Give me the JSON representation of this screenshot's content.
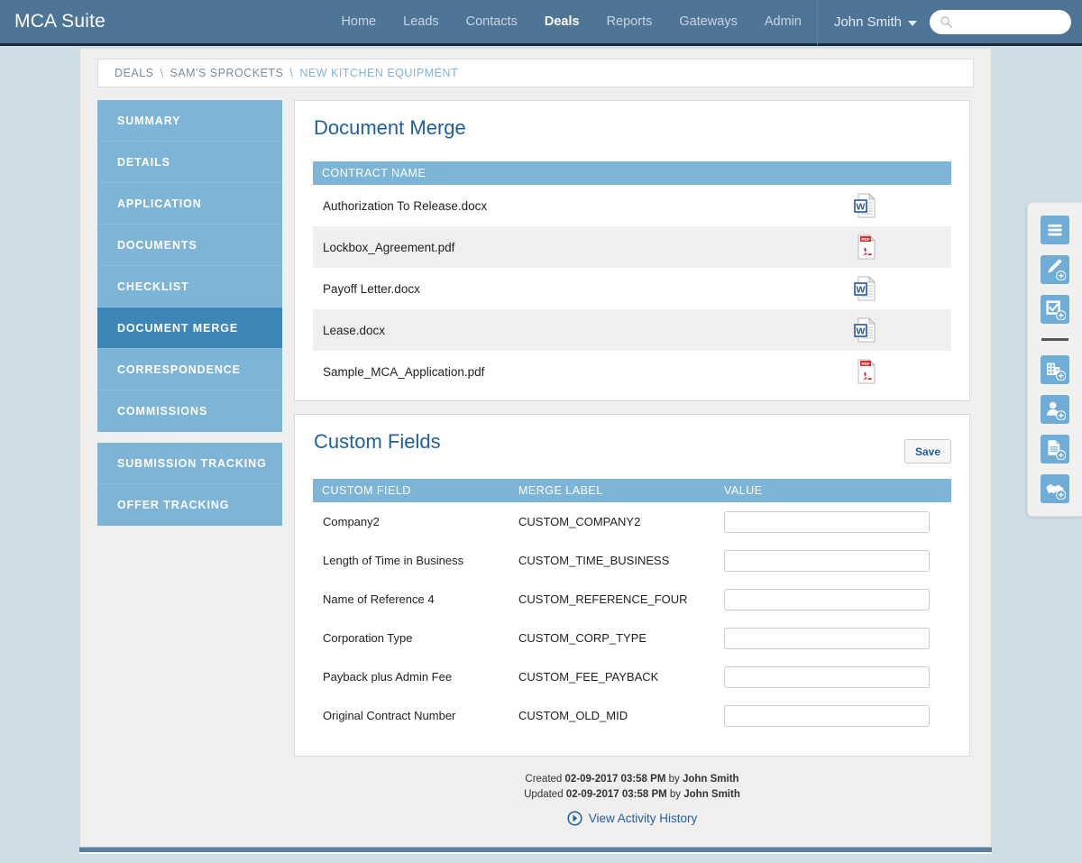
{
  "app": {
    "brand": "MCA Suite"
  },
  "topnav": {
    "links": [
      {
        "label": "Home",
        "active": false
      },
      {
        "label": "Leads",
        "active": false
      },
      {
        "label": "Contacts",
        "active": false
      },
      {
        "label": "Deals",
        "active": true
      },
      {
        "label": "Reports",
        "active": false
      },
      {
        "label": "Gateways",
        "active": false
      },
      {
        "label": "Admin",
        "active": false
      }
    ],
    "user": "John Smith",
    "search_placeholder": "",
    "search_value": "",
    "search_icon": "search-icon"
  },
  "breadcrumb": {
    "items": [
      {
        "label": "DEALS",
        "link": false
      },
      {
        "label": "SAM'S SPROCKETS",
        "link": false
      },
      {
        "label": "NEW KITCHEN EQUIPMENT",
        "link": true
      }
    ],
    "separator": "\\"
  },
  "sidebar": {
    "group1": [
      {
        "label": "SUMMARY",
        "active": false
      },
      {
        "label": "DETAILS",
        "active": false
      },
      {
        "label": "APPLICATION",
        "active": false
      },
      {
        "label": "DOCUMENTS",
        "active": false
      },
      {
        "label": "CHECKLIST",
        "active": false
      },
      {
        "label": "DOCUMENT MERGE",
        "active": true
      },
      {
        "label": "CORRESPONDENCE",
        "active": false
      },
      {
        "label": "COMMISSIONS",
        "active": false
      }
    ],
    "group2": [
      {
        "label": "SUBMISSION TRACKING",
        "active": false
      },
      {
        "label": "OFFER TRACKING",
        "active": false
      }
    ]
  },
  "document_merge": {
    "title": "Document Merge",
    "column_header": "CONTRACT NAME",
    "rows": [
      {
        "name": "Authorization To Release.docx",
        "icon": "word-document-icon",
        "type": "docx"
      },
      {
        "name": "Lockbox_Agreement.pdf",
        "icon": "pdf-document-icon",
        "type": "pdf"
      },
      {
        "name": "Payoff Letter.docx",
        "icon": "word-document-icon",
        "type": "docx"
      },
      {
        "name": "Lease.docx",
        "icon": "word-document-icon",
        "type": "docx"
      },
      {
        "name": "Sample_MCA_Application.pdf",
        "icon": "pdf-document-icon",
        "type": "pdf"
      }
    ]
  },
  "custom_fields": {
    "title": "Custom Fields",
    "save_label": "Save",
    "columns": [
      "CUSTOM FIELD",
      "MERGE LABEL",
      "VALUE"
    ],
    "rows": [
      {
        "field": "Company2",
        "merge_label": "CUSTOM_COMPANY2",
        "value": ""
      },
      {
        "field": "Length of Time in Business",
        "merge_label": "CUSTOM_TIME_BUSINESS",
        "value": ""
      },
      {
        "field": "Name of Reference 4",
        "merge_label": "CUSTOM_REFERENCE_FOUR",
        "value": ""
      },
      {
        "field": "Corporation Type",
        "merge_label": "CUSTOM_CORP_TYPE",
        "value": ""
      },
      {
        "field": "Payback plus Admin Fee",
        "merge_label": "CUSTOM_FEE_PAYBACK",
        "value": ""
      },
      {
        "field": "Original Contract Number",
        "merge_label": "CUSTOM_OLD_MID",
        "value": ""
      }
    ]
  },
  "footer": {
    "created_prefix": "Created ",
    "created_timestamp": "02-09-2017 03:58 PM",
    "created_by_prefix": " by ",
    "created_by": "John Smith",
    "updated_prefix": "Updated ",
    "updated_timestamp": "02-09-2017 03:58 PM",
    "updated_by_prefix": " by ",
    "updated_by": "John Smith",
    "activity_link": "View Activity History"
  },
  "right_toolbar": {
    "items": [
      {
        "icon": "menu-icon",
        "kind": "button"
      },
      {
        "icon": "add-note-icon",
        "kind": "button"
      },
      {
        "icon": "add-task-icon",
        "kind": "button"
      },
      {
        "icon": "divider",
        "kind": "divider"
      },
      {
        "icon": "add-company-icon",
        "kind": "button"
      },
      {
        "icon": "add-contact-icon",
        "kind": "button"
      },
      {
        "icon": "add-document-icon",
        "kind": "button"
      },
      {
        "icon": "add-deal-icon",
        "kind": "button"
      }
    ]
  },
  "colors": {
    "navbar": "#4e7496",
    "page_bg": "#cfdde6",
    "content_bg": "#f0efee",
    "accent_blue": "#7eb4d6",
    "active_blue": "#3d86b8",
    "title_blue": "#1f5f9e",
    "link_blue": "#7fb3e0"
  }
}
